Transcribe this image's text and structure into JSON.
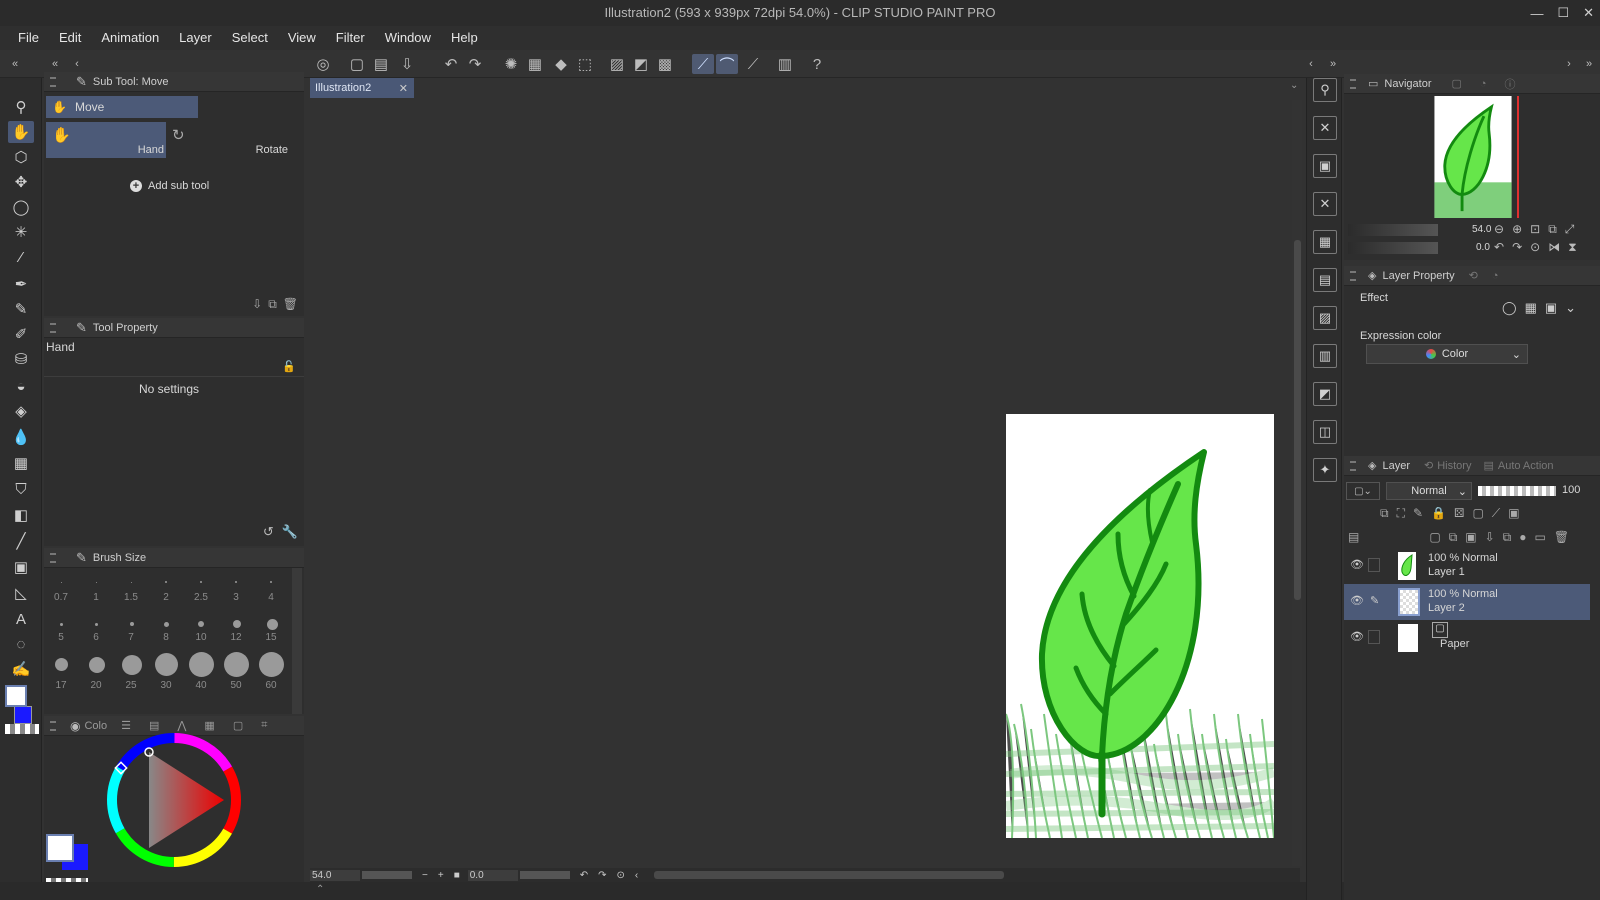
{
  "window": {
    "title": "Illustration2 (593 x 939px 72dpi 54.0%)  - CLIP STUDIO PAINT PRO",
    "controls": {
      "minimize": "—",
      "maximize": "☐",
      "close": "✕"
    }
  },
  "menu": [
    "File",
    "Edit",
    "Animation",
    "Layer",
    "Select",
    "View",
    "Filter",
    "Window",
    "Help"
  ],
  "subtool": {
    "panel_title": "Sub Tool: Move",
    "group": "Move",
    "items": [
      "Hand",
      "Rotate"
    ],
    "add_label": "Add sub tool"
  },
  "tool_property": {
    "panel_title": "Tool Property",
    "tool_name": "Hand",
    "empty_text": "No settings"
  },
  "brush_size": {
    "panel_title": "Brush Size",
    "sizes": [
      "0.7",
      "1",
      "1.5",
      "2",
      "2.5",
      "3",
      "4",
      "5",
      "6",
      "7",
      "8",
      "10",
      "12",
      "15",
      "17",
      "20",
      "25",
      "30",
      "40",
      "50",
      "60"
    ]
  },
  "color": {
    "tab_label": "Colo",
    "r": "255",
    "g": "255",
    "b": "255",
    "main_color": "#ffffff",
    "sub_color": "#1a1aff"
  },
  "document": {
    "tab_label": "Illustration2",
    "zoom": "54.0",
    "rotation": "0.0"
  },
  "navigator": {
    "panel_title": "Navigator",
    "zoom": "54.0",
    "rotation": "0.0"
  },
  "layer_property": {
    "panel_title": "Layer Property",
    "effect_label": "Effect",
    "expression_label": "Expression color",
    "expression_value": "Color"
  },
  "layer_panel": {
    "tabs": [
      "Layer",
      "History",
      "Auto Action"
    ],
    "blend_mode": "Normal",
    "opacity": "100",
    "layers": [
      {
        "mode": "100 % Normal",
        "name": "Layer 1",
        "selected": false
      },
      {
        "mode": "100 % Normal",
        "name": "Layer 2",
        "selected": true
      },
      {
        "mode": "",
        "name": "Paper",
        "selected": false
      }
    ]
  },
  "accent": "#4c5a78"
}
